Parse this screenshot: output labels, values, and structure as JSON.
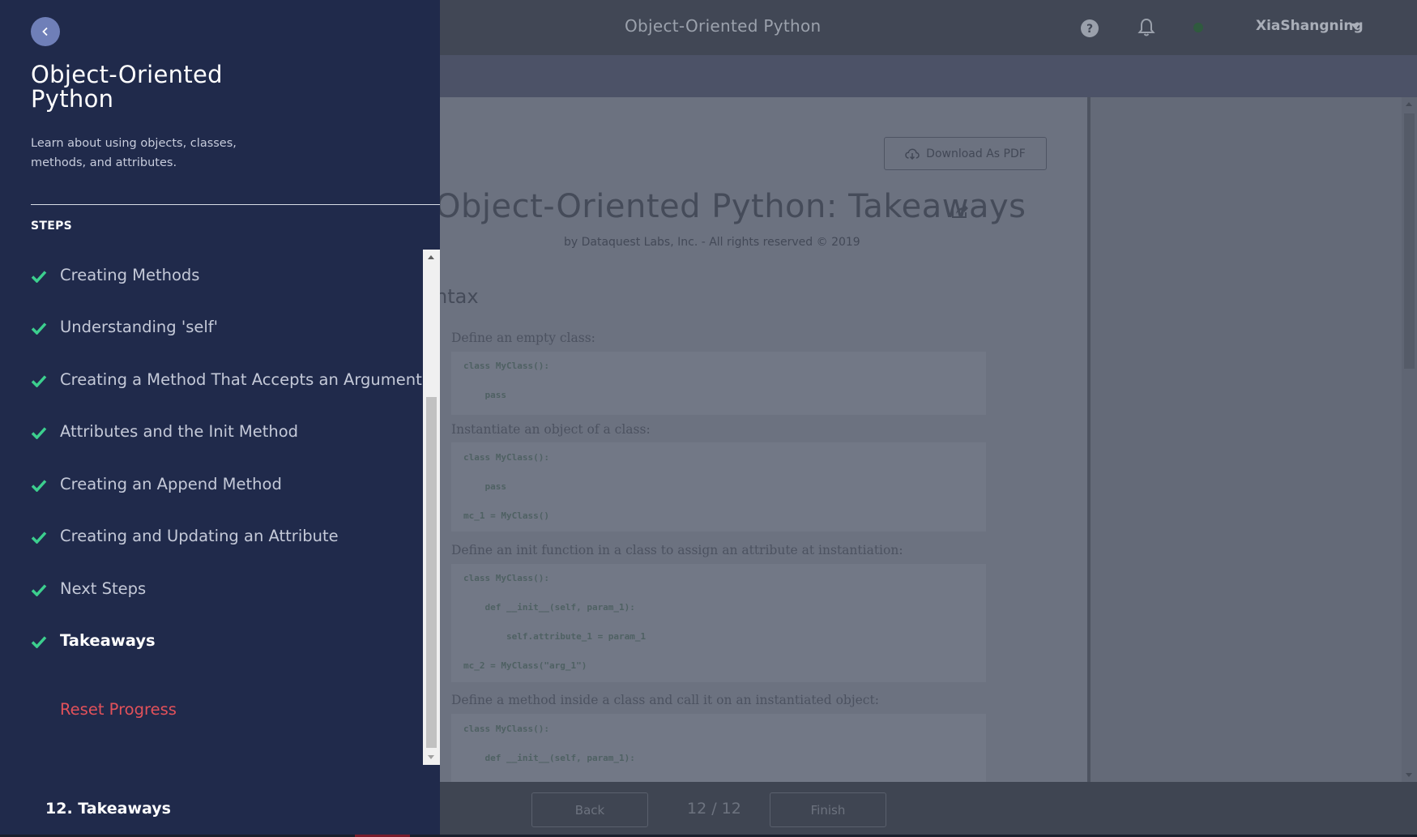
{
  "topbar": {
    "course_title": "Object-Oriented Python",
    "username": "XiaShangning",
    "icons": [
      "help-icon",
      "bell-icon",
      "status-dot-icon",
      "chevron-down-icon"
    ]
  },
  "sidebar": {
    "title_line1": "Object-Oriented",
    "title_line2": "Python",
    "description": "Learn about using objects, classes, methods, and attributes.",
    "steps_label": "STEPS",
    "steps": [
      {
        "label": "Creating Methods",
        "completed": true
      },
      {
        "label": "Understanding 'self'",
        "completed": true
      },
      {
        "label": "Creating a Method That Accepts an Argument",
        "completed": true
      },
      {
        "label": "Attributes and the Init Method",
        "completed": true
      },
      {
        "label": "Creating an Append Method",
        "completed": true
      },
      {
        "label": "Creating and Updating an Attribute",
        "completed": true
      },
      {
        "label": "Next Steps",
        "completed": true
      },
      {
        "label": "Takeaways",
        "completed": true,
        "current": true
      }
    ],
    "reset_label": "Reset Progress",
    "footer_step": "12. Takeaways",
    "check_color": "#3ccf8e",
    "reset_color": "#e2515a"
  },
  "doc": {
    "download_label": "Download As PDF",
    "title": "Object-Oriented Python: Takeaways",
    "byline": "by Dataquest Labs, Inc. - All rights reserved © 2019",
    "section_heading": "ntax",
    "items": [
      {
        "text": "Define an empty class:",
        "code": [
          "class MyClass():",
          "    pass"
        ]
      },
      {
        "text": "Instantiate an object of a class:",
        "code": [
          "class MyClass():",
          "    pass",
          "mc_1 = MyClass()"
        ]
      },
      {
        "text": "Define an init function in a class to assign an attribute at instantiation:",
        "code": [
          "class MyClass():",
          "    def __init__(self, param_1):",
          "        self.attribute_1 = param_1",
          "mc_2 = MyClass(\"arg_1\")"
        ]
      },
      {
        "text": "Define a method inside a class and call it on an instantiated object:",
        "code": [
          "class MyClass():",
          "    def __init__(self, param_1):"
        ]
      }
    ]
  },
  "bottombar": {
    "back_label": "Back",
    "page_indicator": "12 / 12",
    "finish_label": "Finish"
  }
}
